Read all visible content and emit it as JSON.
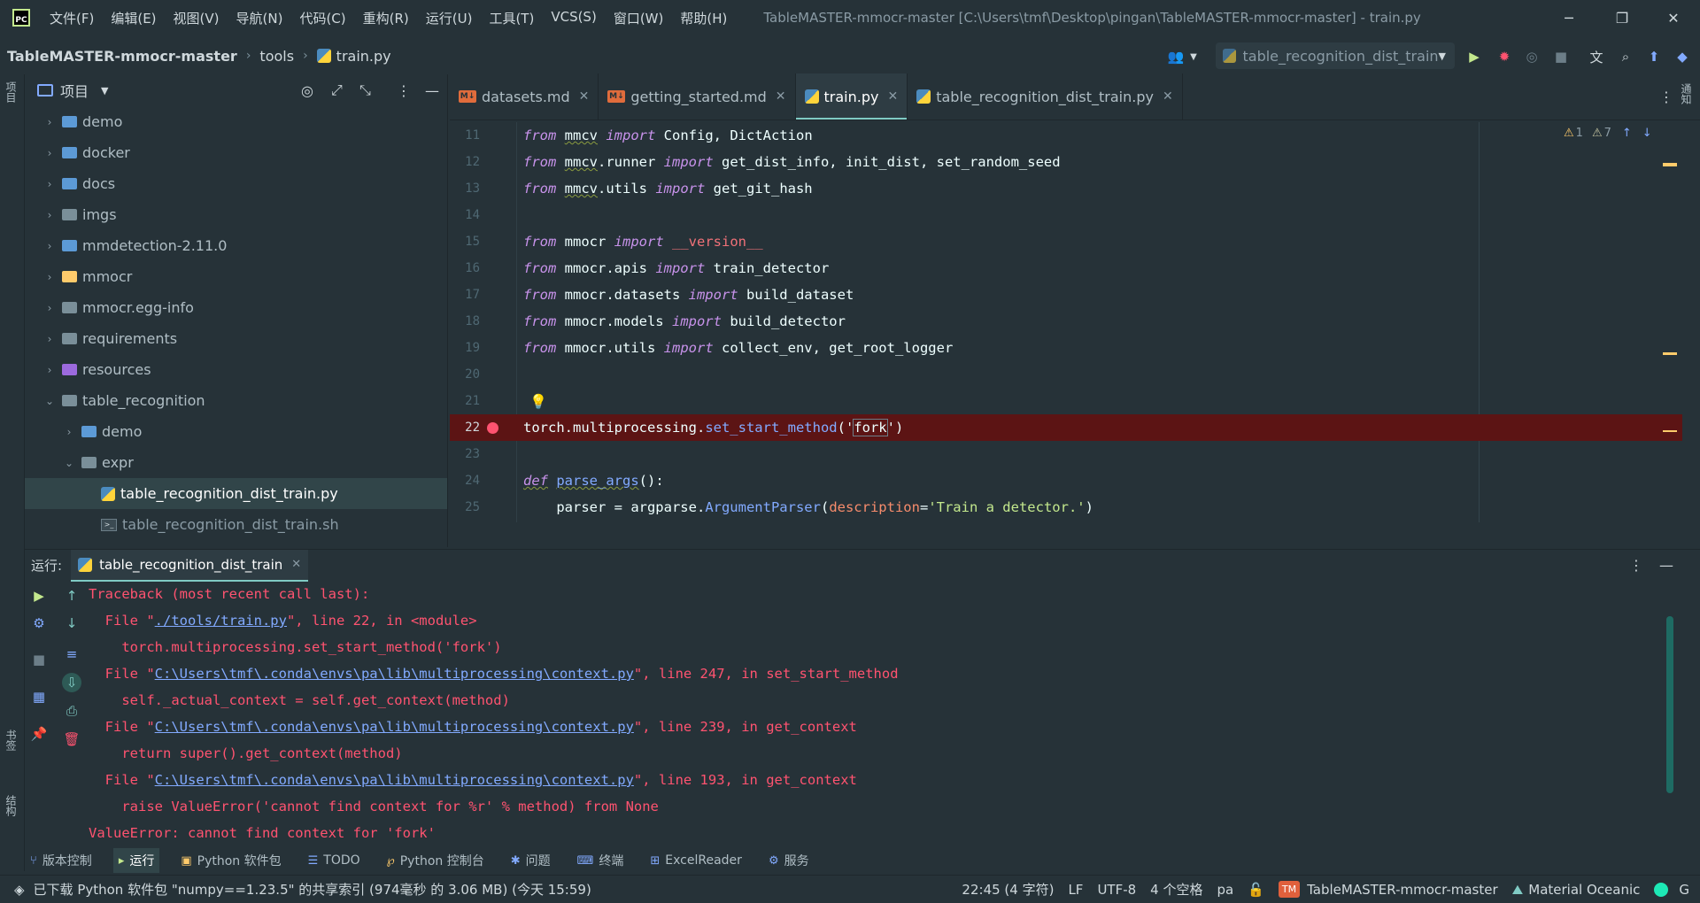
{
  "titlebar": {
    "menu": [
      "文件(F)",
      "编辑(E)",
      "视图(V)",
      "导航(N)",
      "代码(C)",
      "重构(R)",
      "运行(U)",
      "工具(T)",
      "VCS(S)",
      "窗口(W)",
      "帮助(H)"
    ],
    "window_title": "TableMASTER-mmocr-master [C:\\Users\\tmf\\Desktop\\pingan\\TableMASTER-mmocr-master] - train.py",
    "minimize": "─",
    "restore": "❐",
    "close": "✕"
  },
  "navbar": {
    "project": "TableMASTER-mmocr-master",
    "folder": "tools",
    "file": "train.py",
    "run_config": "table_recognition_dist_train"
  },
  "left_strip": {
    "project_label": "项目",
    "bookmarks_label": "书签",
    "structure_label": "结构"
  },
  "right_strip": {
    "notifications_label": "通知"
  },
  "project_panel": {
    "title": "项目",
    "items": [
      {
        "label": "demo",
        "depth": 0,
        "expanded": false,
        "kind": "folder-special"
      },
      {
        "label": "docker",
        "depth": 0,
        "expanded": false,
        "kind": "folder-special"
      },
      {
        "label": "docs",
        "depth": 0,
        "expanded": false,
        "kind": "folder-special"
      },
      {
        "label": "imgs",
        "depth": 0,
        "expanded": false,
        "kind": "folder"
      },
      {
        "label": "mmdetection-2.11.0",
        "depth": 0,
        "expanded": false,
        "kind": "folder-blue"
      },
      {
        "label": "mmocr",
        "depth": 0,
        "expanded": false,
        "kind": "folder-yellow"
      },
      {
        "label": "mmocr.egg-info",
        "depth": 0,
        "expanded": false,
        "kind": "folder"
      },
      {
        "label": "requirements",
        "depth": 0,
        "expanded": false,
        "kind": "folder"
      },
      {
        "label": "resources",
        "depth": 0,
        "expanded": false,
        "kind": "folder-purple"
      },
      {
        "label": "table_recognition",
        "depth": 0,
        "expanded": true,
        "kind": "folder"
      },
      {
        "label": "demo",
        "depth": 1,
        "expanded": false,
        "kind": "folder-special"
      },
      {
        "label": "expr",
        "depth": 1,
        "expanded": true,
        "kind": "folder"
      },
      {
        "label": "table_recognition_dist_train.py",
        "depth": 2,
        "kind": "python",
        "selected": true
      },
      {
        "label": "table_recognition_dist_train.sh",
        "depth": 2,
        "kind": "shell"
      }
    ]
  },
  "editor": {
    "tabs": [
      {
        "label": "datasets.md",
        "kind": "md",
        "active": false
      },
      {
        "label": "getting_started.md",
        "kind": "md",
        "active": false
      },
      {
        "label": "train.py",
        "kind": "python",
        "active": true
      },
      {
        "label": "table_recognition_dist_train.py",
        "kind": "python",
        "active": false
      }
    ],
    "warnings": "1",
    "weak_warnings": "7",
    "lines": [
      {
        "n": "11"
      },
      {
        "n": "12"
      },
      {
        "n": "13"
      },
      {
        "n": "14"
      },
      {
        "n": "15"
      },
      {
        "n": "16"
      },
      {
        "n": "17"
      },
      {
        "n": "18"
      },
      {
        "n": "19"
      },
      {
        "n": "20"
      },
      {
        "n": "21"
      },
      {
        "n": "22"
      },
      {
        "n": "23"
      },
      {
        "n": "24"
      },
      {
        "n": "25"
      }
    ],
    "code": {
      "l11": [
        "from",
        " ",
        "mmcv",
        " ",
        "import",
        " Config, DictAction"
      ],
      "l12": [
        "from",
        " ",
        "mmcv",
        ".runner ",
        "import",
        " get_dist_info, init_dist, set_random_seed"
      ],
      "l13": [
        "from",
        " ",
        "mmcv",
        ".utils ",
        "import",
        " get_git_hash"
      ],
      "l15": [
        "from",
        " mmocr ",
        "import",
        " ",
        "__version__"
      ],
      "l16": [
        "from",
        " mmocr.apis ",
        "import",
        " train_detector"
      ],
      "l17": [
        "from",
        " mmocr.datasets ",
        "import",
        " build_dataset"
      ],
      "l18": [
        "from",
        " mmocr.models ",
        "import",
        " build_detector"
      ],
      "l19": [
        "from",
        " mmocr.utils ",
        "import",
        " collect_env, get_root_logger"
      ],
      "l22": [
        "torch.multiprocessing.",
        "set_start_method",
        "('",
        "fork",
        "')"
      ],
      "l24": [
        "def",
        " ",
        "parse_args",
        "():"
      ],
      "l25": [
        "    parser = argparse.",
        "ArgumentParser",
        "(",
        "description",
        "=",
        "'Train a detector.'",
        ")"
      ]
    }
  },
  "run_panel": {
    "label": "运行:",
    "tab": "table_recognition_dist_train",
    "console": {
      "l1": "Traceback (most recent call last):",
      "l2a": "  File \"",
      "l2link": "./tools/train.py",
      "l2b": "\", line 22, in <module>",
      "l3": "    torch.multiprocessing.set_start_method('fork')",
      "l4a": "  File \"",
      "l4link": "C:\\Users\\tmf\\.conda\\envs\\pa\\lib\\multiprocessing\\context.py",
      "l4b": "\", line 247, in set_start_method",
      "l5": "    self._actual_context = self.get_context(method)",
      "l6a": "  File \"",
      "l6link": "C:\\Users\\tmf\\.conda\\envs\\pa\\lib\\multiprocessing\\context.py",
      "l6b": "\", line 239, in get_context",
      "l7": "    return super().get_context(method)",
      "l8a": "  File \"",
      "l8link": "C:\\Users\\tmf\\.conda\\envs\\pa\\lib\\multiprocessing\\context.py",
      "l8b": "\", line 193, in get_context",
      "l9": "    raise ValueError('cannot find context for %r' % method) from None",
      "l10": "ValueError: cannot find context for 'fork'"
    }
  },
  "bottom_tools": [
    {
      "label": "版本控制",
      "icon": "branch-icon"
    },
    {
      "label": "运行",
      "icon": "play-icon",
      "active": true
    },
    {
      "label": "Python 软件包",
      "icon": "package-icon"
    },
    {
      "label": "TODO",
      "icon": "list-icon"
    },
    {
      "label": "Python 控制台",
      "icon": "console-icon"
    },
    {
      "label": "问题",
      "icon": "bug-icon"
    },
    {
      "label": "终端",
      "icon": "terminal-icon"
    },
    {
      "label": "ExcelReader",
      "icon": "excel-icon"
    },
    {
      "label": "服务",
      "icon": "gear-icon"
    }
  ],
  "statusbar": {
    "message": "已下载 Python 软件包 \"numpy==1.23.5\" 的共享索引 (974毫秒 的 3.06 MB) (今天 15:59)",
    "position": "22:45 (4 字符)",
    "line_sep": "LF",
    "encoding": "UTF-8",
    "indent": "4 个空格",
    "interpreter": "pa",
    "badge": "TM",
    "project": "TableMASTER-mmocr-master",
    "theme": "Material Oceanic"
  },
  "colors": {
    "background": "#263238",
    "accent": "#80cbc4",
    "error": "#ff5370",
    "breakpoint_line": "#5c1414"
  }
}
